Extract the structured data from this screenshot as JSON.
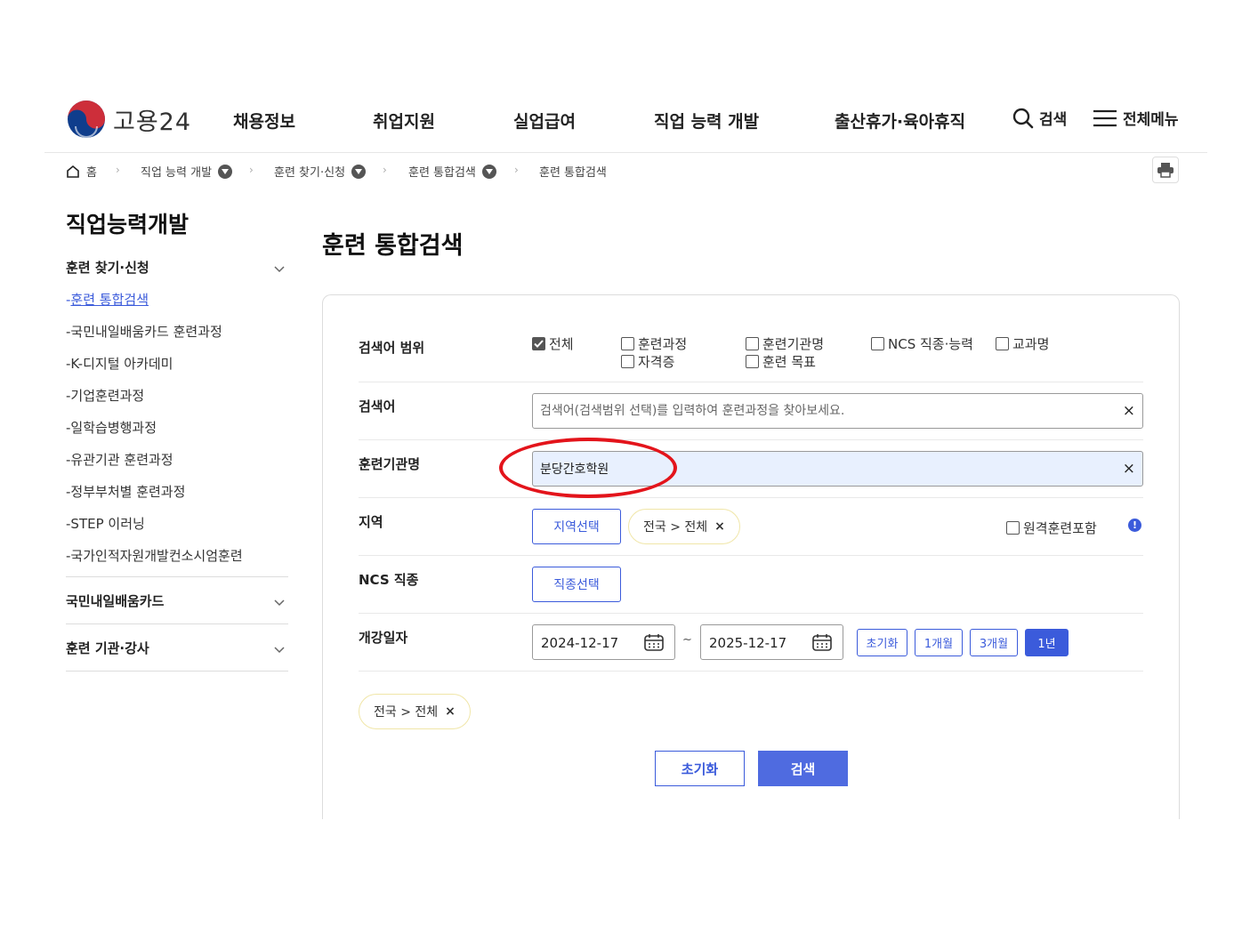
{
  "header": {
    "logo_text": "고용24",
    "nav": [
      "채용정보",
      "취업지원",
      "실업급여",
      "직업 능력 개발",
      "출산휴가·육아휴직"
    ],
    "search_label": "검색",
    "menu_label": "전체메뉴",
    "colors": {
      "logo_red": "#cd2e3a",
      "logo_blue": "#0f3d8c"
    }
  },
  "breadcrumb": {
    "home": "홈",
    "items": [
      "직업 능력 개발",
      "훈련 찾기·신청",
      "훈련 통합검색"
    ],
    "current": "훈련 통합검색"
  },
  "sidebar": {
    "title": "직업능력개발",
    "groups": [
      {
        "label": "훈련 찾기·신청",
        "items": [
          "훈련 통합검색",
          "국민내일배움카드 훈련과정",
          "K-디지털 아카데미",
          "기업훈련과정",
          "일학습병행과정",
          "유관기관 훈련과정",
          "정부부처별 훈련과정",
          "STEP 이러닝",
          "국가인적자원개발컨소시엄훈련"
        ]
      },
      {
        "label": "국민내일배움카드"
      },
      {
        "label": "훈련 기관·강사"
      }
    ],
    "item_prefix": "-"
  },
  "main": {
    "title": "훈련 통합검색",
    "scope": {
      "label": "검색어 범위",
      "options": [
        {
          "label": "전체",
          "checked": true
        },
        {
          "label": "훈련과정",
          "checked": false
        },
        {
          "label": "자격증",
          "checked": false
        },
        {
          "label": "훈련기관명",
          "checked": false
        },
        {
          "label": "훈련 목표",
          "checked": false
        },
        {
          "label": "NCS 직종·능력",
          "checked": false
        },
        {
          "label": "교과명",
          "checked": false
        }
      ]
    },
    "keyword": {
      "label": "검색어",
      "value": "",
      "placeholder": "검색어(검색범위 선택)를 입력하여 훈련과정을 찾아보세요.",
      "clear": "×"
    },
    "institution": {
      "label": "훈련기관명",
      "value": "분당간호학원",
      "clear": "×"
    },
    "region": {
      "label": "지역",
      "button": "지역선택",
      "tag": "전국 > 전체",
      "tag_remove": "×",
      "remote_label": "원격훈련포함",
      "info": "!"
    },
    "ncs": {
      "label": "NCS 직종",
      "button": "직종선택"
    },
    "period": {
      "label": "개강일자",
      "start": "2024-12-17",
      "separator": "~",
      "end": "2025-12-17",
      "buttons": [
        "초기화",
        "1개월",
        "3개월",
        "1년"
      ],
      "active": "1년"
    },
    "selected_tag": "전국 > 전체",
    "selected_tag_remove": "×",
    "reset_button": "초기화",
    "search_button": "검색",
    "accent_color": "#3b5bdb",
    "annotation_color": "#e3141b"
  }
}
